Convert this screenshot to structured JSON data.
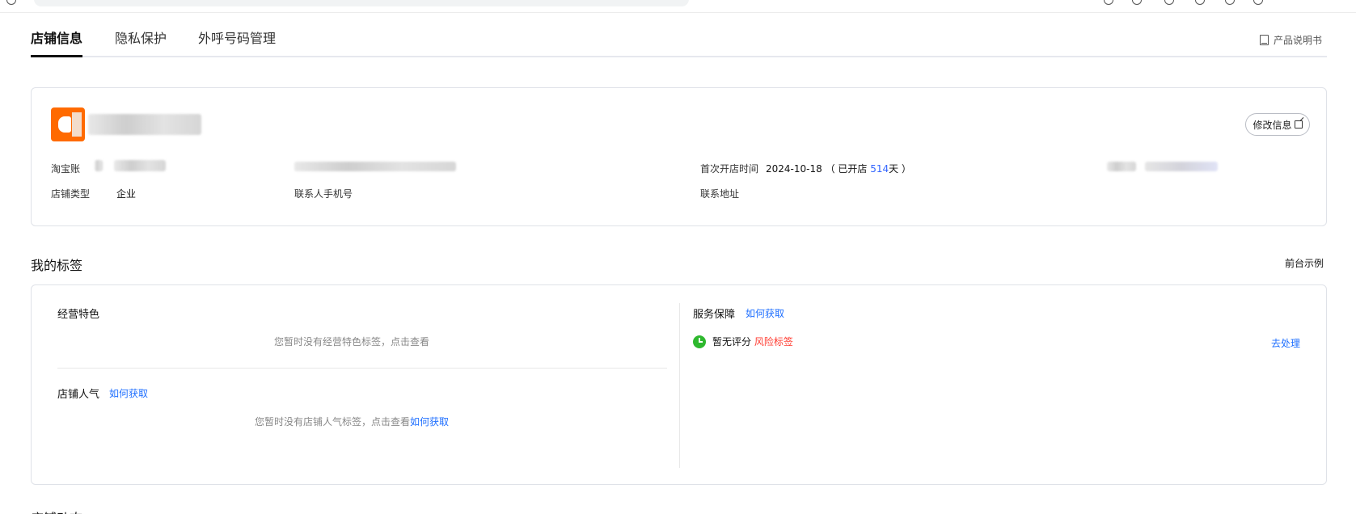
{
  "tabs": {
    "items": [
      {
        "label": "店铺信息",
        "active": true
      },
      {
        "label": "隐私保护",
        "active": false
      },
      {
        "label": "外呼号码管理",
        "active": false
      }
    ],
    "manual_label": "产品说明书"
  },
  "store_info": {
    "edit_label": "修改信息",
    "taobao_label": "淘宝账",
    "store_type_label": "店铺类型",
    "store_type_value": "企业",
    "contact_phone_label": "联系人手机号",
    "open_time_label": "首次开店时间",
    "open_date": "2024-10-18",
    "open_prefix": "（ 已开店 ",
    "open_days": "514",
    "open_suffix": "天 ）",
    "address_label": "联系地址"
  },
  "tags_section": {
    "title": "我的标签",
    "example_label": "前台示例",
    "business_feature": {
      "title": "经营特色",
      "empty_text": "您暂时没有经营特色标签，点击查看"
    },
    "popularity": {
      "title": "店铺人气",
      "how_label": "如何获取",
      "empty_text": "您暂时没有店铺人气标签，点击查看",
      "empty_link": "如何获取"
    },
    "service": {
      "title": "服务保障",
      "how_label": "如何获取",
      "status_text": "暂无评分",
      "risk_label": "风险标签",
      "process_label": "去处理"
    }
  },
  "next_section_title": "店铺动态",
  "colors": {
    "accent": "#1f6fff",
    "days": "#3366ff",
    "risk": "#ff3b30",
    "logo": "#ff6a00",
    "status_ok": "#2eb82e"
  }
}
